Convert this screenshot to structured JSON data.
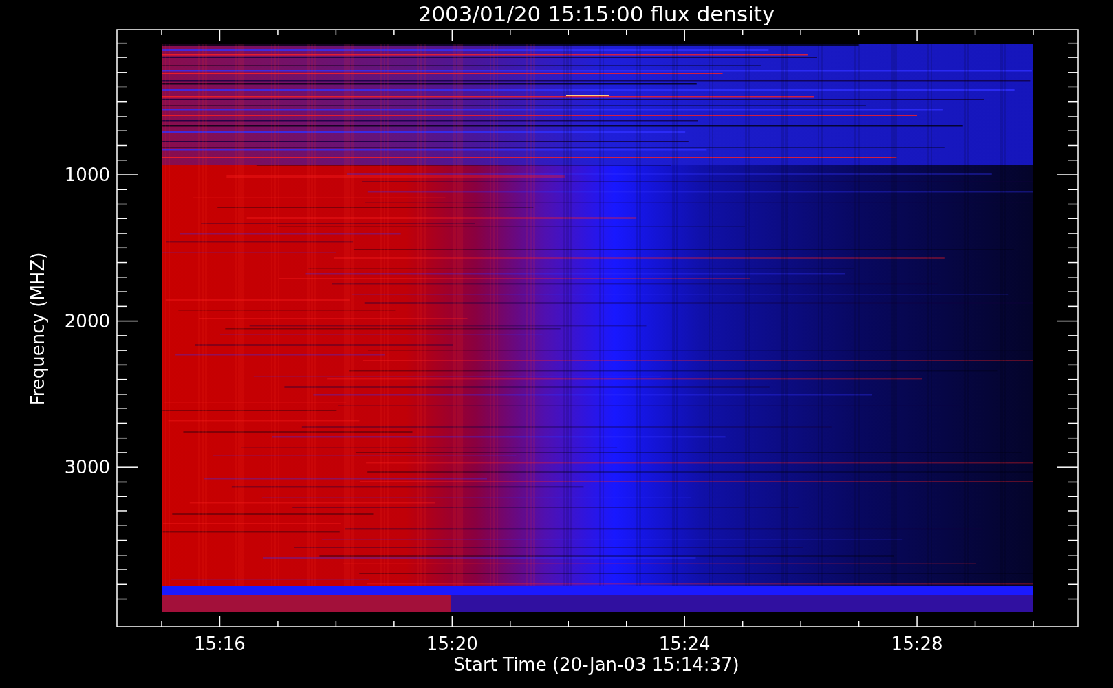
{
  "title": "2003/01/20 15:15:00 flux density",
  "xlabel": "Start Time (20-Jan-03 15:14:37)",
  "ylabel": "Frequency (MHZ)",
  "xticks": [
    {
      "label": "15:16"
    },
    {
      "label": "15:20"
    },
    {
      "label": "15:24"
    },
    {
      "label": "15:28"
    }
  ],
  "yticks": [
    {
      "label": "1000"
    },
    {
      "label": "2000"
    },
    {
      "label": "3000"
    }
  ]
}
